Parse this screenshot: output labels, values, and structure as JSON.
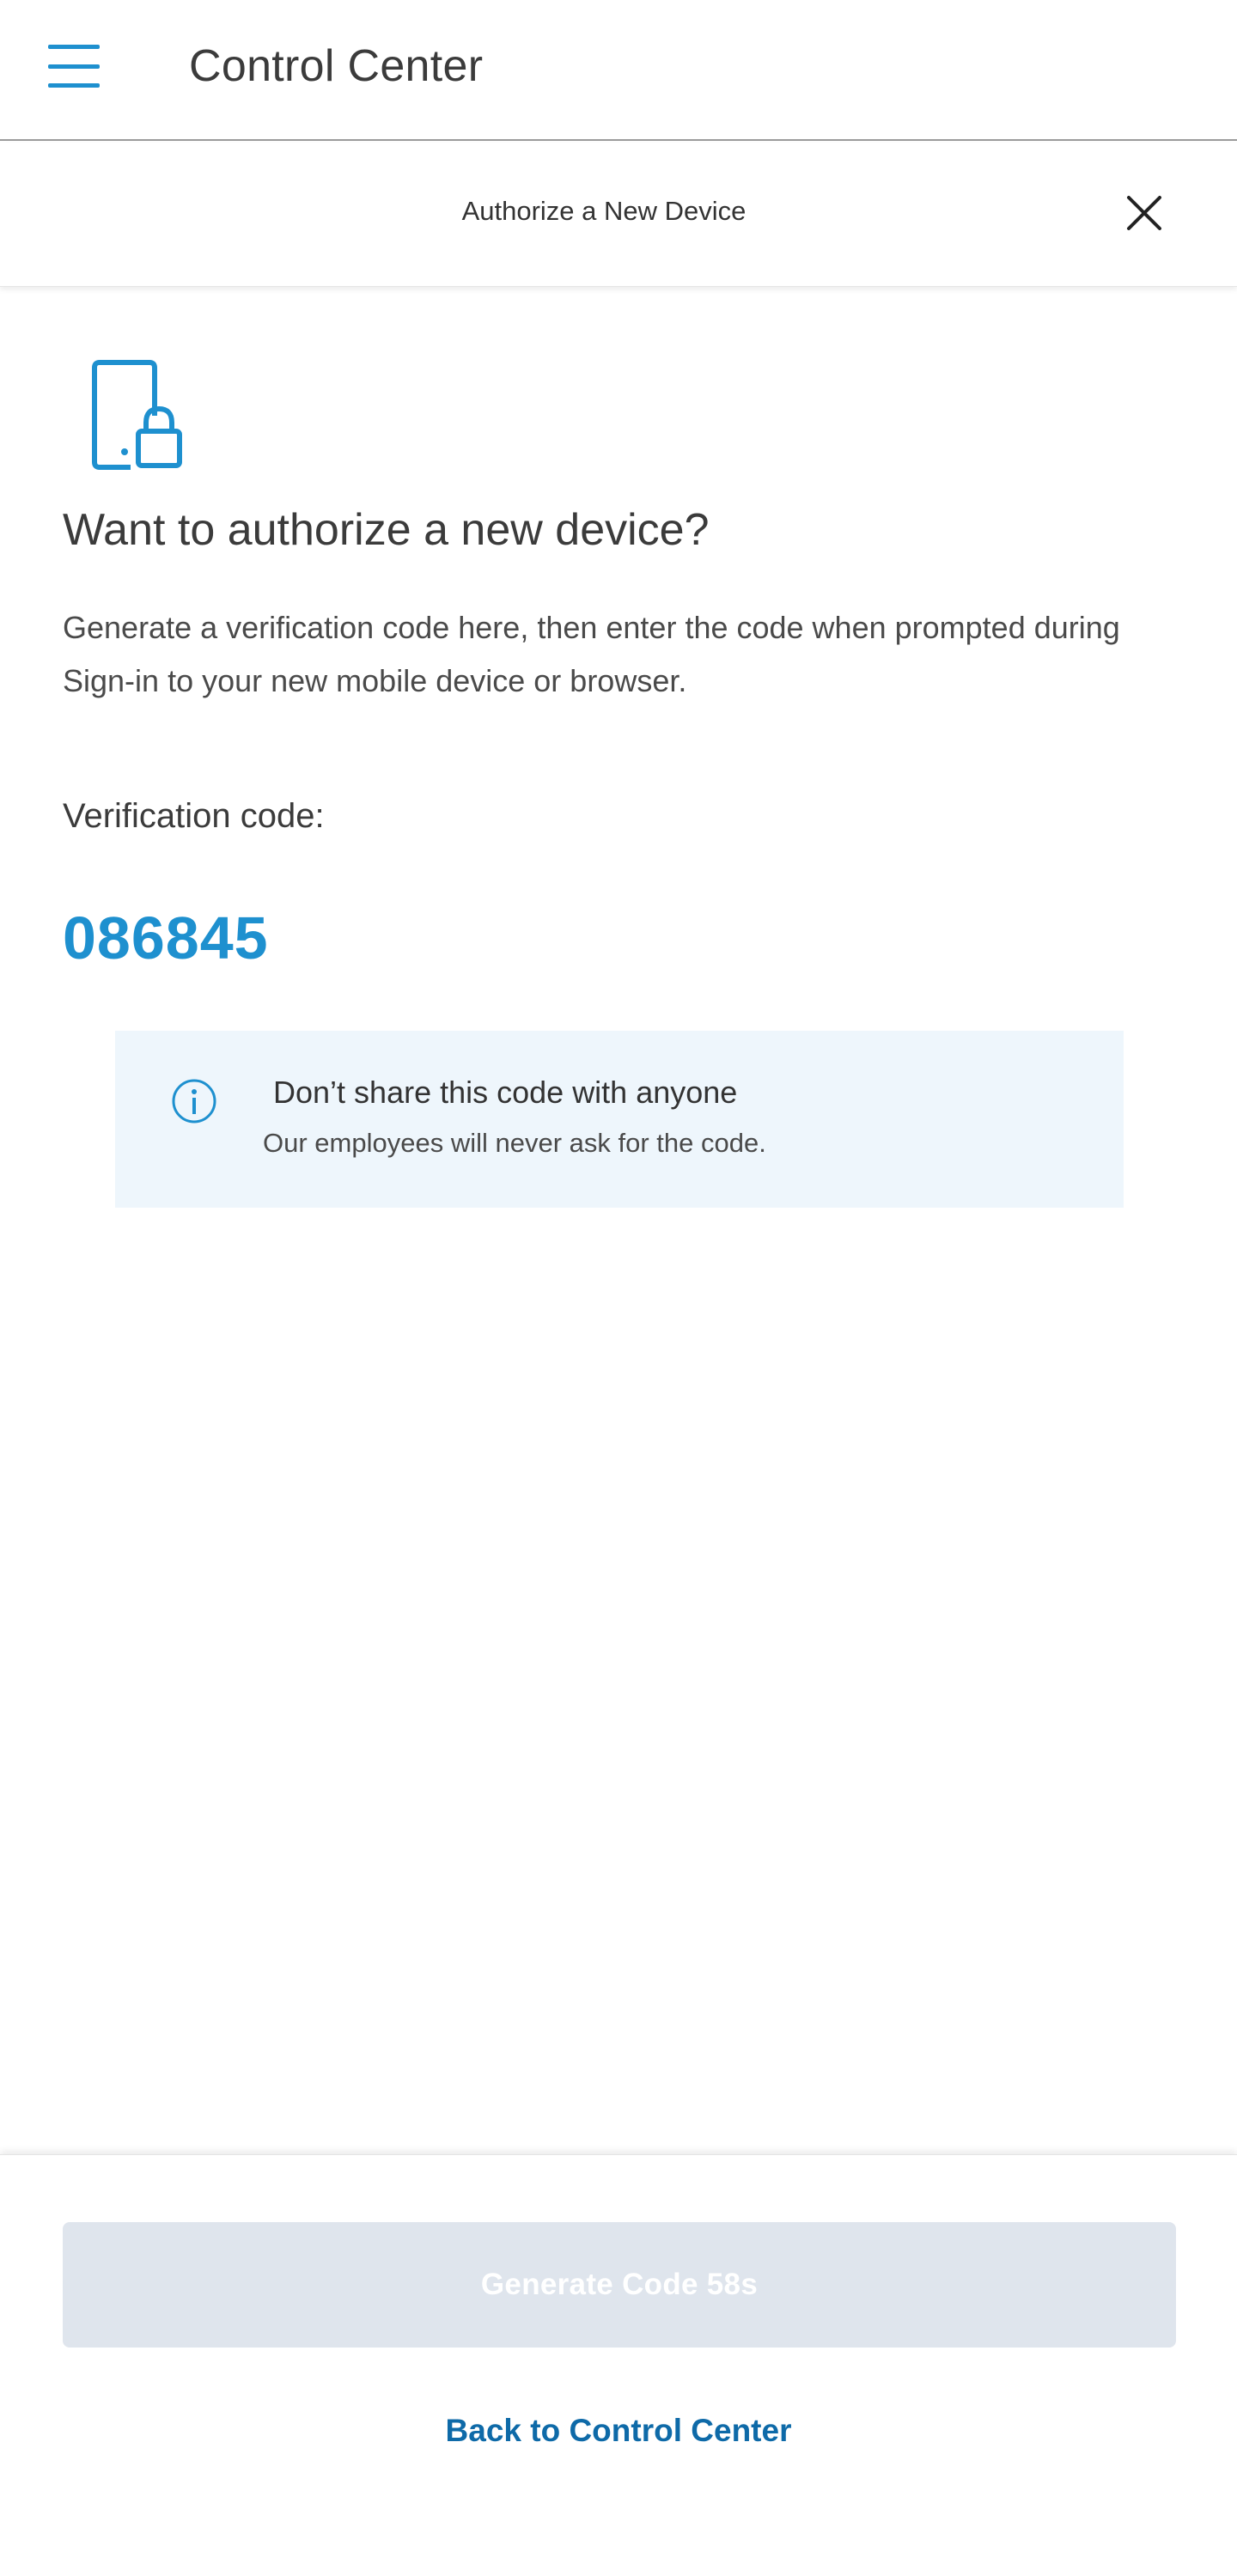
{
  "topbar": {
    "title": "Control Center",
    "menu_icon": "hamburger-menu-icon",
    "accent_color": "#1e90cf"
  },
  "subheader": {
    "title": "Authorize a New Device",
    "close_icon": "close-icon"
  },
  "content": {
    "icon": "device-lock-icon",
    "heading": "Want to authorize a new device?",
    "description": "Generate a verification code here, then enter the code when prompted during Sign-in to your new mobile device or browser.",
    "code_label": "Verification code:",
    "code_value": "086845",
    "code_color": "#1e90cf"
  },
  "notice": {
    "icon": "info-icon",
    "title": "Don’t share this code with anyone",
    "text": "Our employees will never ask for the code.",
    "background": "#eef6fc"
  },
  "footer": {
    "generate_button_label": "Generate Code 58s",
    "generate_button_disabled": true,
    "back_link_label": "Back to Control Center",
    "link_color": "#0e6aa8"
  }
}
